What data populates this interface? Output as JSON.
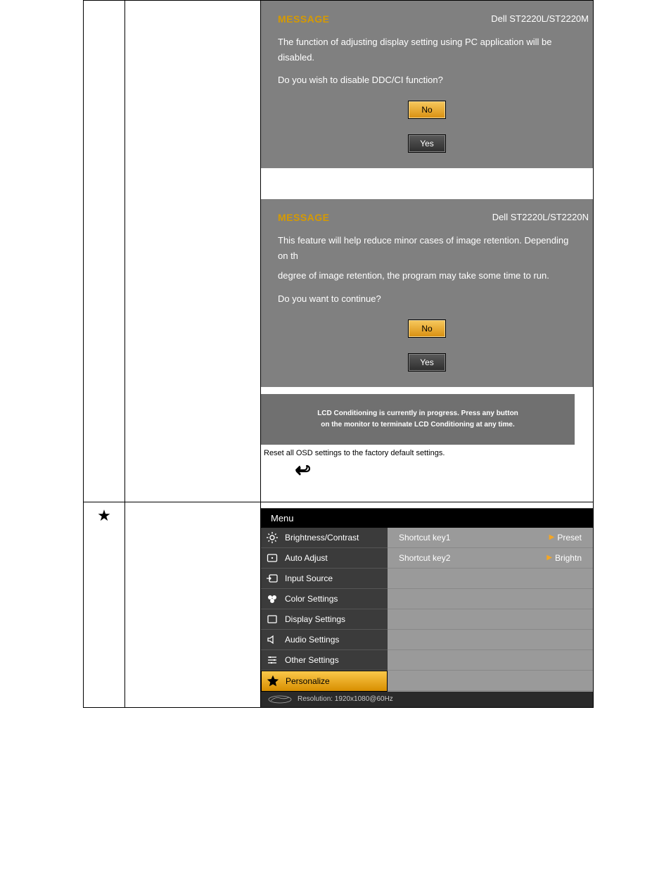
{
  "dialog1": {
    "header": "MESSAGE",
    "model": "Dell ST2220L/ST2220M",
    "line1": "The function of adjusting display setting using PC application will be disabled.",
    "line2": "Do you wish to disable DDC/CI function?",
    "no": "No",
    "yes": "Yes"
  },
  "dialog2": {
    "header": "MESSAGE",
    "model": "Dell ST2220L/ST2220N",
    "line1": "This feature will help reduce minor cases of image retention. Depending on th",
    "line2": "degree of image retention, the program may take some time to run.",
    "line3": "Do you want to continue?",
    "no": "No",
    "yes": "Yes"
  },
  "progress": {
    "l1": "LCD Conditioning is currently in progress. Press any button",
    "l2": "on the monitor to terminate LCD Conditioning at any time."
  },
  "factory_text": "Reset all OSD settings to the factory default settings.",
  "menu": {
    "title": "Menu",
    "items": [
      {
        "label": "Brightness/Contrast"
      },
      {
        "label": "Auto Adjust"
      },
      {
        "label": "Input Source"
      },
      {
        "label": "Color Settings"
      },
      {
        "label": "Display Settings"
      },
      {
        "label": "Audio Settings"
      },
      {
        "label": "Other Settings"
      },
      {
        "label": "Personalize"
      }
    ],
    "right": [
      {
        "label": "Shortcut key1",
        "value": "Preset"
      },
      {
        "label": "Shortcut key2",
        "value": "Brightn"
      }
    ],
    "resolution": "Resolution:  1920x1080@60Hz"
  }
}
